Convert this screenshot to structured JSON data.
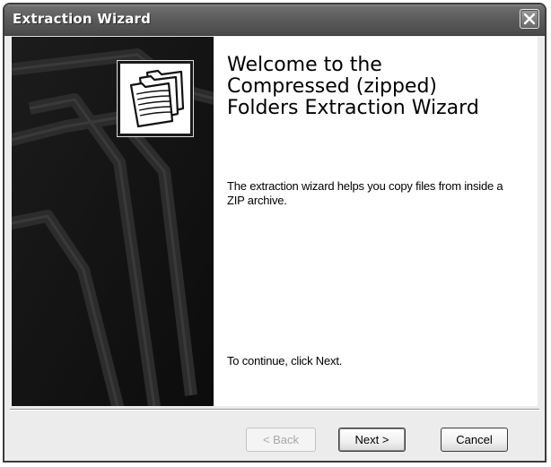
{
  "window": {
    "title": "Extraction Wizard"
  },
  "main": {
    "heading": "Welcome to the Compressed (zipped) Folders Extraction Wizard",
    "description": "The extraction wizard helps you copy files from inside a ZIP archive.",
    "continue_text": "To continue, click Next."
  },
  "buttons": {
    "back": "< Back",
    "next": "Next >",
    "cancel": "Cancel"
  },
  "icons": {
    "close": "close-icon",
    "wizard": "compressed-folders-icon"
  },
  "colors": {
    "titlebar": "#5a5a5a",
    "side_panel": "#141414",
    "dialog_bg": "#ececec"
  }
}
